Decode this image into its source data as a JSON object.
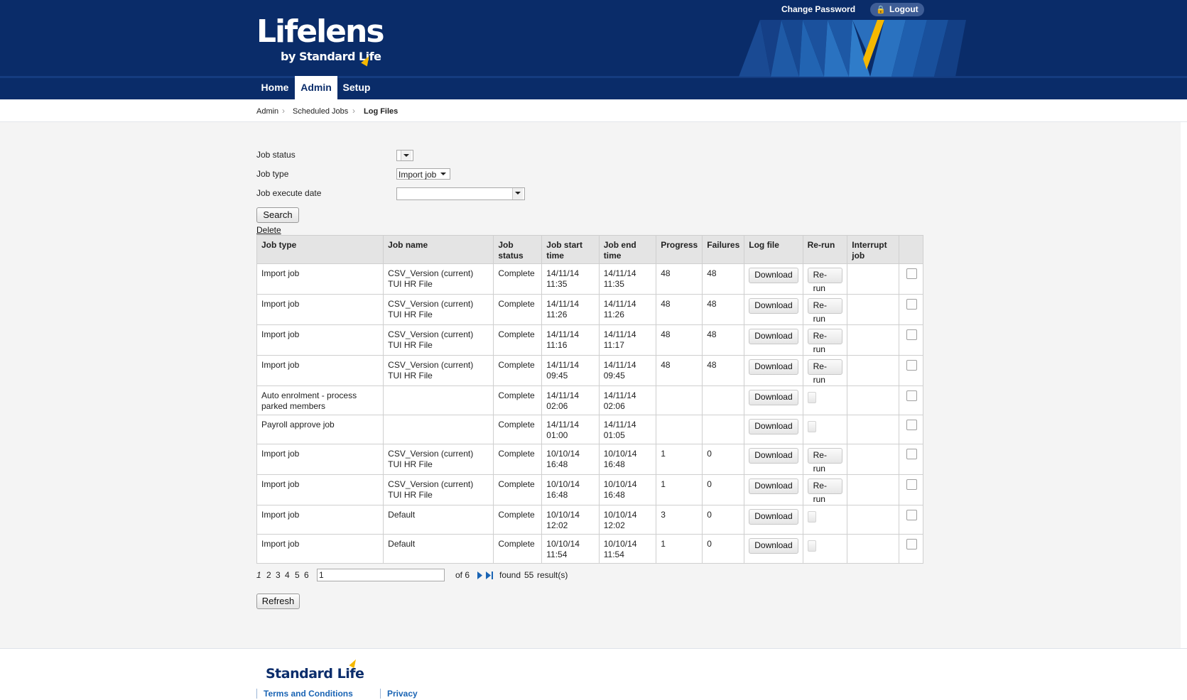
{
  "header": {
    "brand": "Lifelens",
    "brand_sub": "by Standard Life",
    "change_password": "Change Password",
    "logout": "Logout",
    "tabs": [
      {
        "label": "Home"
      },
      {
        "label": "Admin",
        "active": true
      },
      {
        "label": "Setup"
      }
    ]
  },
  "breadcrumb": [
    "Admin",
    "Scheduled Jobs",
    "Log Files"
  ],
  "filters": {
    "job_status_label": "Job status",
    "job_status_value": "",
    "job_type_label": "Job type",
    "job_type_value": "Import job",
    "job_execute_date_label": "Job execute date",
    "job_execute_date_value": ""
  },
  "actions": {
    "search": "Search",
    "delete": "Delete",
    "refresh": "Refresh"
  },
  "table": {
    "headers": [
      "Job type",
      "Job name",
      "Job status",
      "Job start time",
      "Job end time",
      "Progress",
      "Failures",
      "Log file",
      "Re-run",
      "Interrupt job",
      ""
    ],
    "download_label": "Download",
    "rerun_label": "Re-run",
    "rows": [
      {
        "type": "Import job",
        "name": "CSV_Version (current) TUI HR File",
        "status": "Complete",
        "start": "14/11/14 11:35",
        "end": "14/11/14 11:35",
        "progress": "48",
        "failures": "48",
        "rerun": true
      },
      {
        "type": "Import job",
        "name": "CSV_Version (current) TUI HR File",
        "status": "Complete",
        "start": "14/11/14 11:26",
        "end": "14/11/14 11:26",
        "progress": "48",
        "failures": "48",
        "rerun": true
      },
      {
        "type": "Import job",
        "name": "CSV_Version (current) TUI HR File",
        "status": "Complete",
        "start": "14/11/14 11:16",
        "end": "14/11/14 11:17",
        "progress": "48",
        "failures": "48",
        "rerun": true
      },
      {
        "type": "Import job",
        "name": "CSV_Version (current) TUI HR File",
        "status": "Complete",
        "start": "14/11/14 09:45",
        "end": "14/11/14 09:45",
        "progress": "48",
        "failures": "48",
        "rerun": true
      },
      {
        "type": "Auto enrolment - process parked members",
        "name": "",
        "status": "Complete",
        "start": "14/11/14 02:06",
        "end": "14/11/14 02:06",
        "progress": "",
        "failures": "",
        "rerun": false
      },
      {
        "type": "Payroll approve job",
        "name": "",
        "status": "Complete",
        "start": "14/11/14 01:00",
        "end": "14/11/14 01:05",
        "progress": "",
        "failures": "",
        "rerun": false
      },
      {
        "type": "Import job",
        "name": "CSV_Version (current) TUI HR File",
        "status": "Complete",
        "start": "10/10/14 16:48",
        "end": "10/10/14 16:48",
        "progress": "1",
        "failures": "0",
        "rerun": true
      },
      {
        "type": "Import job",
        "name": "CSV_Version (current) TUI HR File",
        "status": "Complete",
        "start": "10/10/14 16:48",
        "end": "10/10/14 16:48",
        "progress": "1",
        "failures": "0",
        "rerun": true
      },
      {
        "type": "Import job",
        "name": "Default",
        "status": "Complete",
        "start": "10/10/14 12:02",
        "end": "10/10/14 12:02",
        "progress": "3",
        "failures": "0",
        "rerun": false
      },
      {
        "type": "Import job",
        "name": "Default",
        "status": "Complete",
        "start": "10/10/14 11:54",
        "end": "10/10/14 11:54",
        "progress": "1",
        "failures": "0",
        "rerun": false
      }
    ]
  },
  "pagination": {
    "pages": [
      "1",
      "2",
      "3",
      "4",
      "5",
      "6"
    ],
    "current_page": "1",
    "page_input": "1",
    "of_text": "of 6",
    "found_text": "found",
    "result_count": "55",
    "results_text": "result(s)"
  },
  "footer": {
    "logo": "Standard Life",
    "terms": "Terms and Conditions",
    "privacy": "Privacy"
  },
  "colors": {
    "header_bg": "#0a2c69",
    "accent_yellow": "#f5b800",
    "link_blue": "#1a64b4"
  }
}
